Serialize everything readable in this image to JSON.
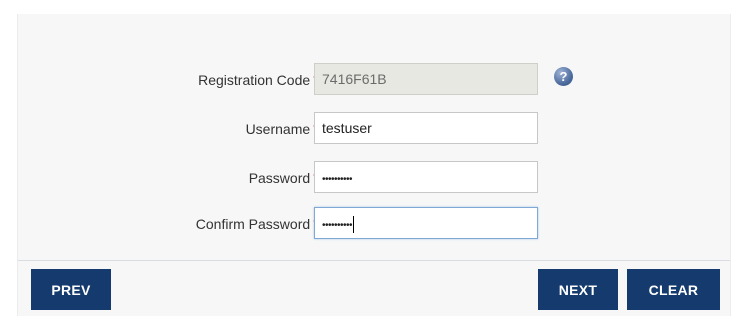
{
  "form": {
    "registration_code": {
      "label": "Registration Code",
      "required_mark": "*",
      "value": "7416F61B"
    },
    "username": {
      "label": "Username",
      "required_mark": "*",
      "value": "testuser"
    },
    "password": {
      "label": "Password",
      "required_mark": "*",
      "masked_value": "••••••••••"
    },
    "confirm_password": {
      "label": "Confirm Password",
      "required_mark": "*",
      "masked_value": "••••••••••"
    },
    "help_icon": "?"
  },
  "buttons": {
    "prev": "PREV",
    "next": "NEXT",
    "clear": "CLEAR"
  },
  "colors": {
    "button_bg": "#143a6e",
    "required_mark": "#d0312d",
    "panel_bg": "#f7f7f7",
    "readonly_field_bg": "#e8e8e3"
  },
  "icons": {
    "help": "help-circle-icon"
  }
}
